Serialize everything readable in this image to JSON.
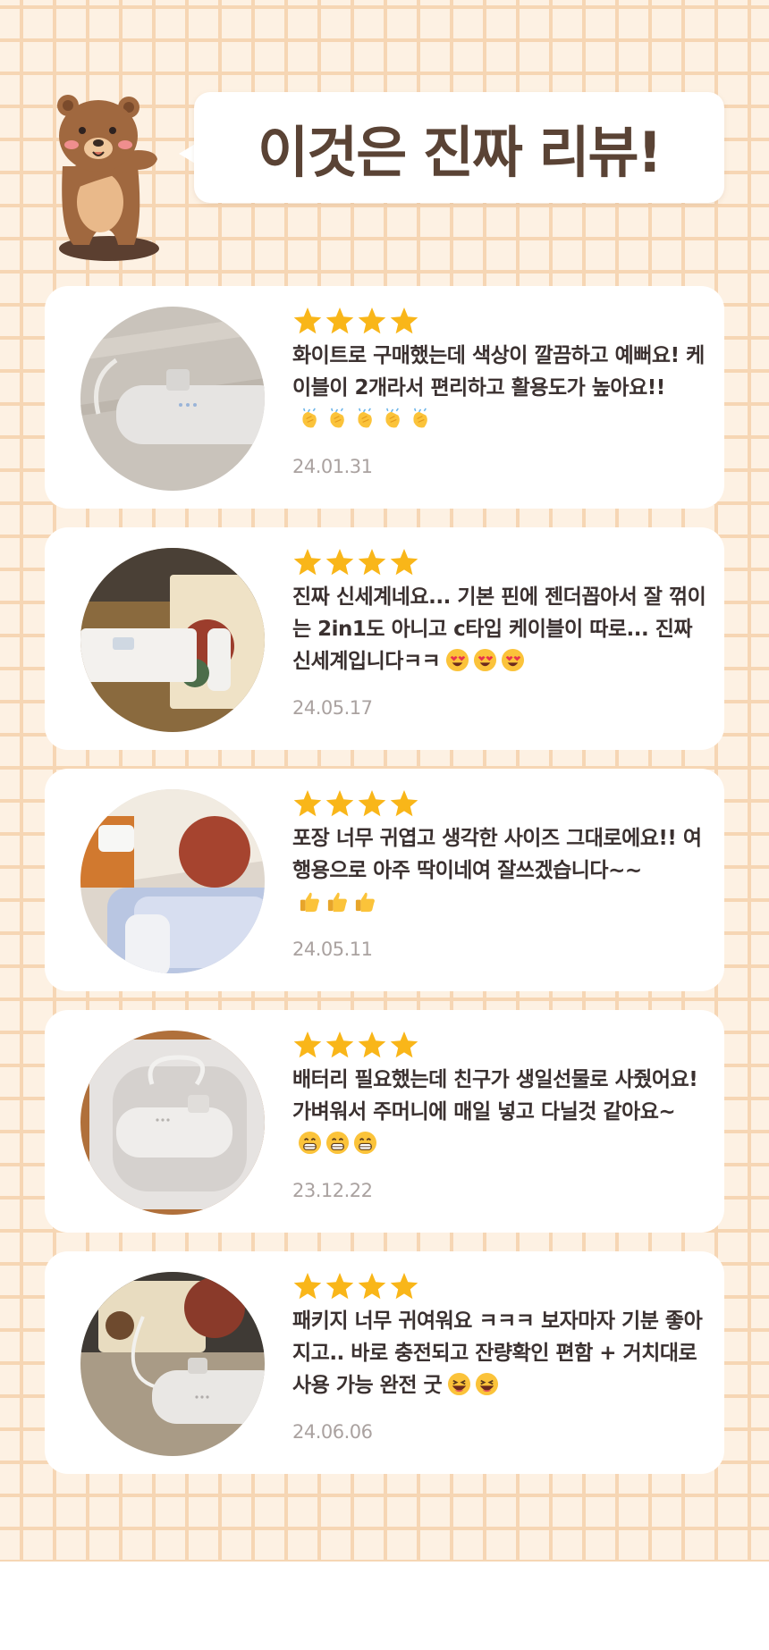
{
  "header": {
    "title": "이것은 진짜 리뷰!"
  },
  "reviews": [
    {
      "rating": 4,
      "text": "화이트로 구매했는데 색상이 깔끔하고 예뻐요! 케이블이 2개라서 편리하고 활용도가 높아요!!",
      "emoji": "clapping-hands",
      "emoji_count": 5,
      "date": "24.01.31",
      "photo": "white-powerbank-on-wood"
    },
    {
      "rating": 4,
      "text": "진짜 신세계네요... 기본 핀에 젠더꼽아서 잘 꺾이는 2in1도 아니고 c타입 케이블이 따로... 진짜 신세계입니다ㅋㅋ",
      "emoji": "heart-eyes-face",
      "emoji_count": 3,
      "date": "24.05.17",
      "photo": "powerbank-with-box"
    },
    {
      "rating": 4,
      "text": "포장 너무 귀엽고 생각한 사이즈 그대로에요!! 여행용으로 아주 딱이네여 잘쓰겠습니다~~",
      "emoji": "thumbs-up",
      "emoji_count": 3,
      "date": "24.05.11",
      "photo": "packaging-and-tray"
    },
    {
      "rating": 4,
      "text": "배터리 필요했는데 친구가 생일선물로 사줬어요! 가벼워서 주머니에 매일 넣고 다닐것 같아요~",
      "emoji": "grinning-face",
      "emoji_count": 3,
      "date": "23.12.22",
      "photo": "powerbank-in-tray"
    },
    {
      "rating": 4,
      "text": "패키지 너무 귀여워요 ㅋㅋㅋ 보자마자 기분 좋아지고.. 바로 충전되고 잔량확인 편함 + 거치대로 사용 가능 완전 굿",
      "emoji": "laughing-face",
      "emoji_count": 2,
      "date": "24.06.06",
      "photo": "powerbank-with-cable"
    }
  ],
  "colors": {
    "background_grid": "#fdf1e3",
    "grid_lines": "#f6d6b4",
    "title_text": "#5a4335",
    "star": "#f9b619",
    "review_text": "#3b3130",
    "date_text": "#aaa2a0"
  }
}
